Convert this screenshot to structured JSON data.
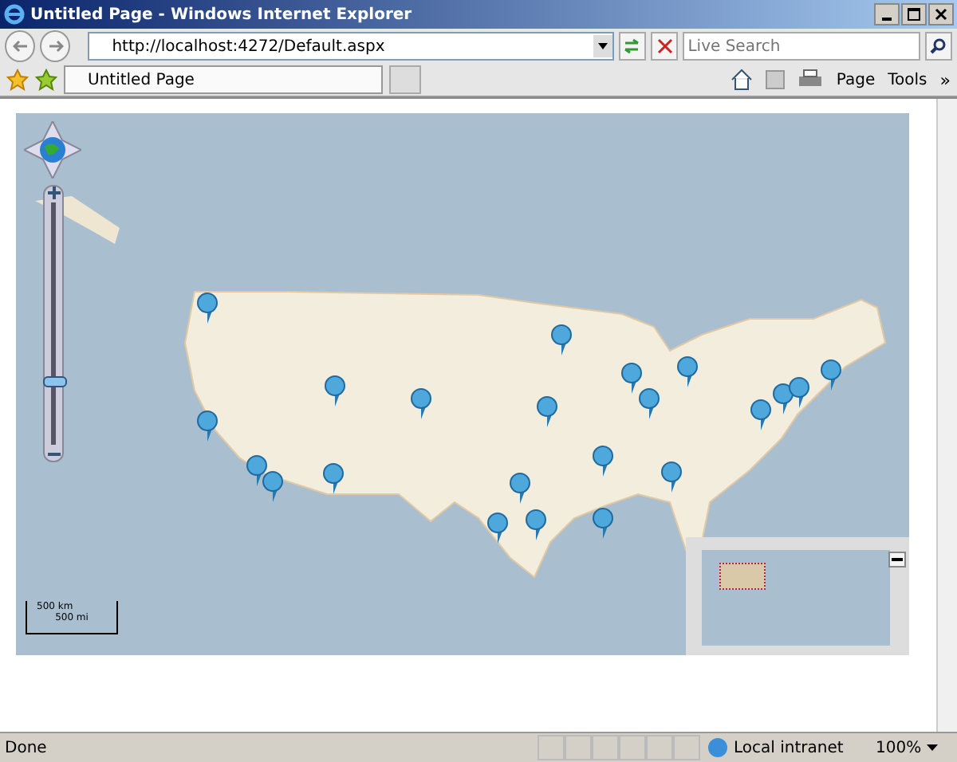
{
  "window": {
    "title": "Untitled Page - Windows Internet Explorer"
  },
  "address_bar": {
    "url": "http://localhost:4272/Default.aspx"
  },
  "search": {
    "placeholder": "Live Search"
  },
  "tabs": [
    {
      "label": "Untitled Page",
      "selected": true
    }
  ],
  "toolbar": {
    "items": [
      {
        "label": "Page"
      },
      {
        "label": "Tools"
      }
    ],
    "more": "»"
  },
  "map": {
    "zoom_slider": {
      "level": 0.24
    },
    "scale": {
      "km": "500 km",
      "mi": "500 mi"
    }
  },
  "status_bar": {
    "text": "Done",
    "zone": "Local intranet",
    "zoom": "100%"
  }
}
